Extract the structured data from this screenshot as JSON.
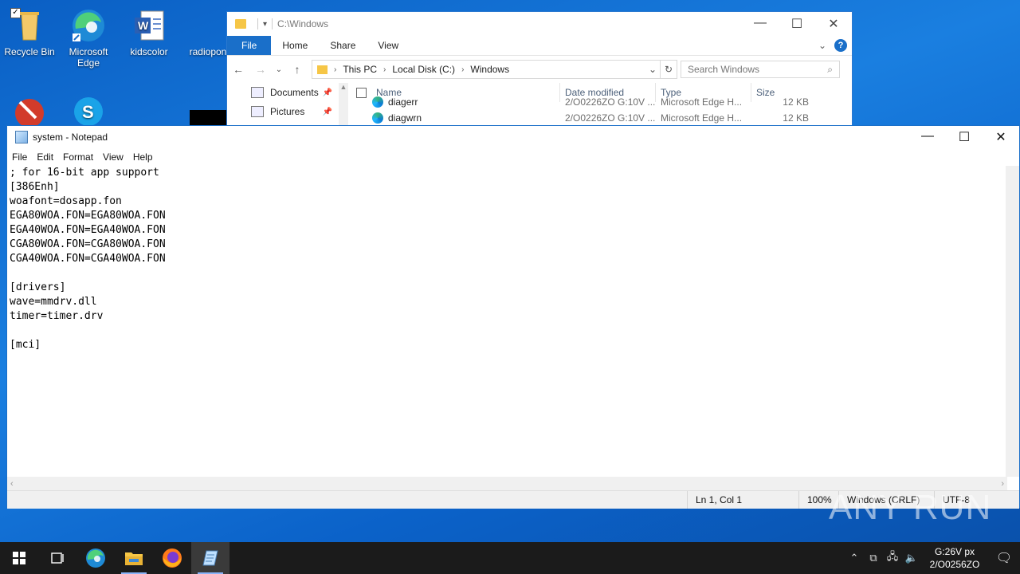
{
  "desktop": {
    "icons": [
      {
        "label": "Recycle Bin",
        "icon": "recycle-bin-icon"
      },
      {
        "label": "Microsoft Edge",
        "icon": "edge-icon"
      },
      {
        "label": "kidscolor",
        "icon": "word-document-icon"
      },
      {
        "label": "radiopon",
        "icon": "file-icon"
      }
    ]
  },
  "explorer": {
    "title": "C:\\Windows",
    "ribbon_tabs": [
      "File",
      "Home",
      "Share",
      "View"
    ],
    "breadcrumb": [
      "This PC",
      "Local Disk (C:)",
      "Windows"
    ],
    "search_placeholder": "Search Windows",
    "nav_items": [
      {
        "label": "Documents",
        "icon": "documents-icon"
      },
      {
        "label": "Pictures",
        "icon": "pictures-icon"
      }
    ],
    "columns": [
      "Name",
      "Date modified",
      "Type",
      "Size"
    ],
    "files": [
      {
        "name": "diagerr",
        "date": "2/O0226ZO G:10V ...",
        "type": "Microsoft Edge H...",
        "size": "12 KB"
      },
      {
        "name": "diagwrn",
        "date": "2/O0226ZO G:10V ...",
        "type": "Microsoft Edge H...",
        "size": "12 KB"
      }
    ]
  },
  "notepad": {
    "title": "system - Notepad",
    "menu": [
      "File",
      "Edit",
      "Format",
      "View",
      "Help"
    ],
    "content": "; for 16-bit app support\n[386Enh]\nwoafont=dosapp.fon\nEGA80WOA.FON=EGA80WOA.FON\nEGA40WOA.FON=EGA40WOA.FON\nCGA80WOA.FON=CGA80WOA.FON\nCGA40WOA.FON=CGA40WOA.FON\n\n[drivers]\nwave=mmdrv.dll\ntimer=timer.drv\n\n[mci]",
    "status": {
      "position": "Ln 1, Col 1",
      "zoom": "100%",
      "line_ending": "Windows (CRLF)",
      "encoding": "UTF-8"
    }
  },
  "watermark": "ANY RUN",
  "taskbar": {
    "apps": [
      {
        "name": "start-button",
        "icon": "windows-logo-icon"
      },
      {
        "name": "task-view-button",
        "icon": "task-view-icon"
      },
      {
        "name": "edge-taskbar",
        "icon": "edge-icon"
      },
      {
        "name": "file-explorer-taskbar",
        "icon": "folder-icon"
      },
      {
        "name": "firefox-taskbar",
        "icon": "firefox-icon"
      },
      {
        "name": "notepad-taskbar",
        "icon": "notepad-icon"
      }
    ],
    "clock_time": "G:26V px",
    "clock_date": "2/O0256ZO"
  }
}
